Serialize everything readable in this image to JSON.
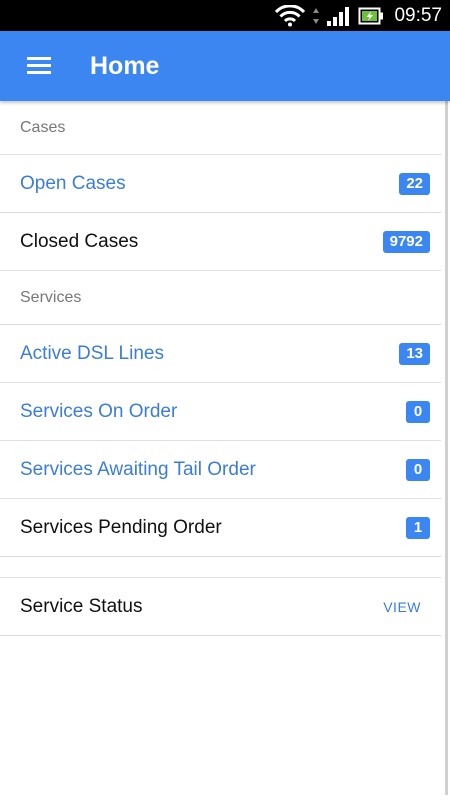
{
  "status_bar": {
    "time": "09:57",
    "icons": [
      "wifi-icon",
      "signal-icon",
      "battery-charging-icon"
    ]
  },
  "app_bar": {
    "title": "Home",
    "menu_icon": "hamburger-menu-icon",
    "color": "#3b86f0"
  },
  "sections": {
    "cases": {
      "header": "Cases",
      "items": [
        {
          "label": "Open Cases",
          "count": "22"
        },
        {
          "label": "Closed Cases",
          "count": "9792"
        }
      ]
    },
    "services": {
      "header": "Services",
      "items": [
        {
          "label": "Active DSL Lines",
          "count": "13"
        },
        {
          "label": "Services On Order",
          "count": "0"
        },
        {
          "label": "Services Awaiting Tail Order",
          "count": "0"
        },
        {
          "label": "Services Pending Order",
          "count": "1"
        }
      ]
    },
    "service_status": {
      "label": "Service Status",
      "action": "VIEW"
    }
  },
  "colors": {
    "accent": "#3b86f0",
    "link_text": "#3b7dd8",
    "badge": "#3b86f0"
  }
}
